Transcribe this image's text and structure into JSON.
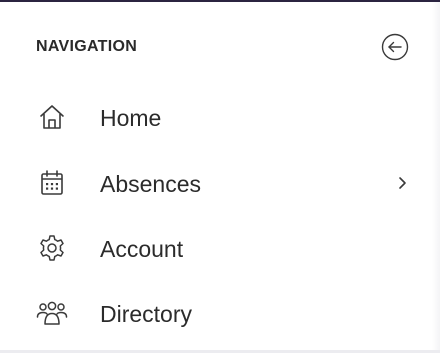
{
  "navigation": {
    "title": "NAVIGATION",
    "collapse_icon": "arrow-left-circle-icon",
    "items": [
      {
        "label": "Home",
        "icon": "home-icon",
        "has_submenu": false
      },
      {
        "label": "Absences",
        "icon": "calendar-icon",
        "has_submenu": true
      },
      {
        "label": "Account",
        "icon": "gear-icon",
        "has_submenu": false
      },
      {
        "label": "Directory",
        "icon": "people-icon",
        "has_submenu": false
      }
    ]
  },
  "colors": {
    "text": "#2b2b2b",
    "icon_stroke": "#3a3a3a",
    "top_border": "#2b2440"
  }
}
